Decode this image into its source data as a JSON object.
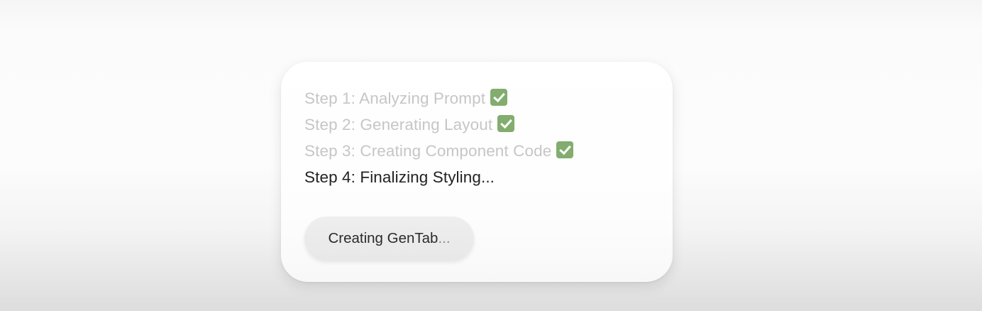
{
  "progress_card": {
    "steps": [
      {
        "label": "Step 1: Analyzing Prompt",
        "status": "done",
        "status_icon": "check-mark-icon"
      },
      {
        "label": "Step 2: Generating Layout",
        "status": "done",
        "status_icon": "check-mark-icon"
      },
      {
        "label": "Step 3: Creating Component Code",
        "status": "done",
        "status_icon": "check-mark-icon"
      },
      {
        "label": "Step 4: Finalizing Styling...",
        "status": "in-progress"
      }
    ],
    "button": {
      "label": "Creating GenTab",
      "ellipsis": "..."
    }
  },
  "colors": {
    "done_text": "#c6c6c6",
    "active_text": "#222222",
    "check_green": "#82ad6e"
  }
}
